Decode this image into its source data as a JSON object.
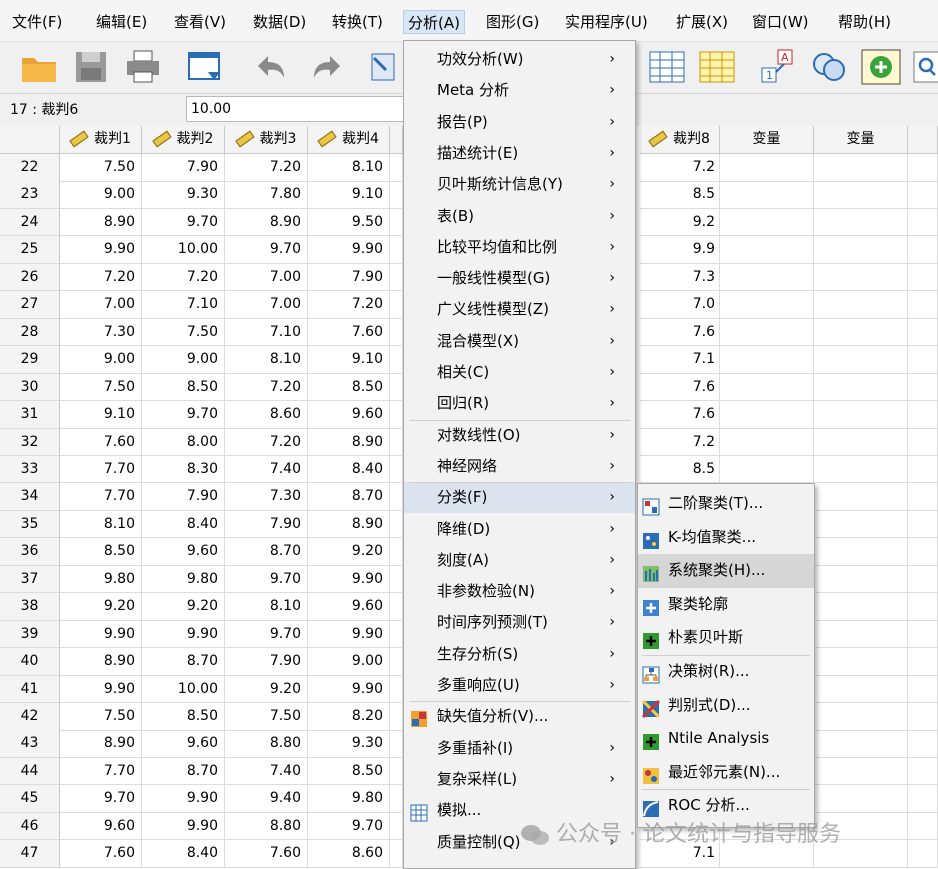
{
  "menubar": [
    "文件(F)",
    "编辑(E)",
    "查看(V)",
    "数据(D)",
    "转换(T)",
    "分析(A)",
    "图形(G)",
    "实用程序(U)",
    "扩展(X)",
    "窗口(W)",
    "帮助(H)"
  ],
  "cell_editor": {
    "ref": "17 : 裁判6",
    "value": "10.00"
  },
  "columns": [
    "裁判1",
    "裁判2",
    "裁判3",
    "裁判4",
    "裁判8",
    "变量",
    "变量"
  ],
  "rows": [
    {
      "n": "22",
      "v": [
        "7.50",
        "7.90",
        "7.20",
        "8.10"
      ],
      "v8": "7.2"
    },
    {
      "n": "23",
      "v": [
        "9.00",
        "9.30",
        "7.80",
        "9.10"
      ],
      "v8": "8.5"
    },
    {
      "n": "24",
      "v": [
        "8.90",
        "9.70",
        "8.90",
        "9.50"
      ],
      "v8": "9.2"
    },
    {
      "n": "25",
      "v": [
        "9.90",
        "10.00",
        "9.70",
        "9.90"
      ],
      "v8": "9.9"
    },
    {
      "n": "26",
      "v": [
        "7.20",
        "7.20",
        "7.00",
        "7.90"
      ],
      "v8": "7.3"
    },
    {
      "n": "27",
      "v": [
        "7.00",
        "7.10",
        "7.00",
        "7.20"
      ],
      "v8": "7.0"
    },
    {
      "n": "28",
      "v": [
        "7.30",
        "7.50",
        "7.10",
        "7.60"
      ],
      "v8": "7.6"
    },
    {
      "n": "29",
      "v": [
        "9.00",
        "9.00",
        "8.10",
        "9.10"
      ],
      "v8": "7.1"
    },
    {
      "n": "30",
      "v": [
        "7.50",
        "8.50",
        "7.20",
        "8.50"
      ],
      "v8": "7.6"
    },
    {
      "n": "31",
      "v": [
        "9.10",
        "9.70",
        "8.60",
        "9.60"
      ],
      "v8": "7.6"
    },
    {
      "n": "32",
      "v": [
        "7.60",
        "8.00",
        "7.20",
        "8.90"
      ],
      "v8": "7.2"
    },
    {
      "n": "33",
      "v": [
        "7.70",
        "8.30",
        "7.40",
        "8.40"
      ],
      "v8": "8.5"
    },
    {
      "n": "34",
      "v": [
        "7.70",
        "7.90",
        "7.30",
        "8.70"
      ],
      "v8": ""
    },
    {
      "n": "35",
      "v": [
        "8.10",
        "8.40",
        "7.90",
        "8.90"
      ],
      "v8": ""
    },
    {
      "n": "36",
      "v": [
        "8.50",
        "9.60",
        "8.70",
        "9.20"
      ],
      "v8": ""
    },
    {
      "n": "37",
      "v": [
        "9.80",
        "9.80",
        "9.70",
        "9.90"
      ],
      "v8": ""
    },
    {
      "n": "38",
      "v": [
        "9.20",
        "9.20",
        "8.10",
        "9.60"
      ],
      "v8": ""
    },
    {
      "n": "39",
      "v": [
        "9.90",
        "9.90",
        "9.70",
        "9.90"
      ],
      "v8": ""
    },
    {
      "n": "40",
      "v": [
        "8.90",
        "8.70",
        "7.90",
        "9.00"
      ],
      "v8": ""
    },
    {
      "n": "41",
      "v": [
        "9.90",
        "10.00",
        "9.20",
        "9.90"
      ],
      "v8": ""
    },
    {
      "n": "42",
      "v": [
        "7.50",
        "8.50",
        "7.50",
        "8.20"
      ],
      "v8": ""
    },
    {
      "n": "43",
      "v": [
        "8.90",
        "9.60",
        "8.80",
        "9.30"
      ],
      "v8": ""
    },
    {
      "n": "44",
      "v": [
        "7.70",
        "8.70",
        "7.40",
        "8.50"
      ],
      "v8": ""
    },
    {
      "n": "45",
      "v": [
        "9.70",
        "9.90",
        "9.40",
        "9.80"
      ],
      "v8": ""
    },
    {
      "n": "46",
      "v": [
        "9.60",
        "9.90",
        "8.80",
        "9.70"
      ],
      "v8": ""
    },
    {
      "n": "47",
      "v": [
        "7.60",
        "8.40",
        "7.60",
        "8.60"
      ],
      "v8": "7.1"
    }
  ],
  "analyze_menu": [
    {
      "label": "功效分析(W)",
      "arrow": true
    },
    {
      "label": "Meta 分析",
      "arrow": true
    },
    {
      "label": "报告(P)",
      "arrow": true
    },
    {
      "label": "描述统计(E)",
      "arrow": true
    },
    {
      "label": "贝叶斯统计信息(Y)",
      "arrow": true
    },
    {
      "label": "表(B)",
      "arrow": true
    },
    {
      "label": "比较平均值和比例",
      "arrow": true
    },
    {
      "label": "一般线性模型(G)",
      "arrow": true
    },
    {
      "label": "广义线性模型(Z)",
      "arrow": true
    },
    {
      "label": "混合模型(X)",
      "arrow": true
    },
    {
      "label": "相关(C)",
      "arrow": true
    },
    {
      "label": "回归(R)",
      "arrow": true
    },
    {
      "label": "对数线性(O)",
      "arrow": true
    },
    {
      "label": "神经网络",
      "arrow": true
    },
    {
      "label": "分类(F)",
      "arrow": true
    },
    {
      "label": "降维(D)",
      "arrow": true
    },
    {
      "label": "刻度(A)",
      "arrow": true
    },
    {
      "label": "非参数检验(N)",
      "arrow": true
    },
    {
      "label": "时间序列预测(T)",
      "arrow": true
    },
    {
      "label": "生存分析(S)",
      "arrow": true
    },
    {
      "label": "多重响应(U)",
      "arrow": true
    },
    {
      "label": "缺失值分析(V)...",
      "arrow": false
    },
    {
      "label": "多重插补(I)",
      "arrow": true
    },
    {
      "label": "复杂采样(L)",
      "arrow": true
    },
    {
      "label": "模拟...",
      "arrow": false
    },
    {
      "label": "质量控制(Q)",
      "arrow": true
    }
  ],
  "classify_submenu": [
    "二阶聚类(T)...",
    "K-均值聚类...",
    "系统聚类(H)...",
    "聚类轮廓",
    "朴素贝叶斯",
    "决策树(R)...",
    "判别式(D)...",
    "Ntile Analysis",
    "最近邻元素(N)...",
    "ROC 分析..."
  ],
  "watermark": "公众号 · 论文统计与指导服务"
}
